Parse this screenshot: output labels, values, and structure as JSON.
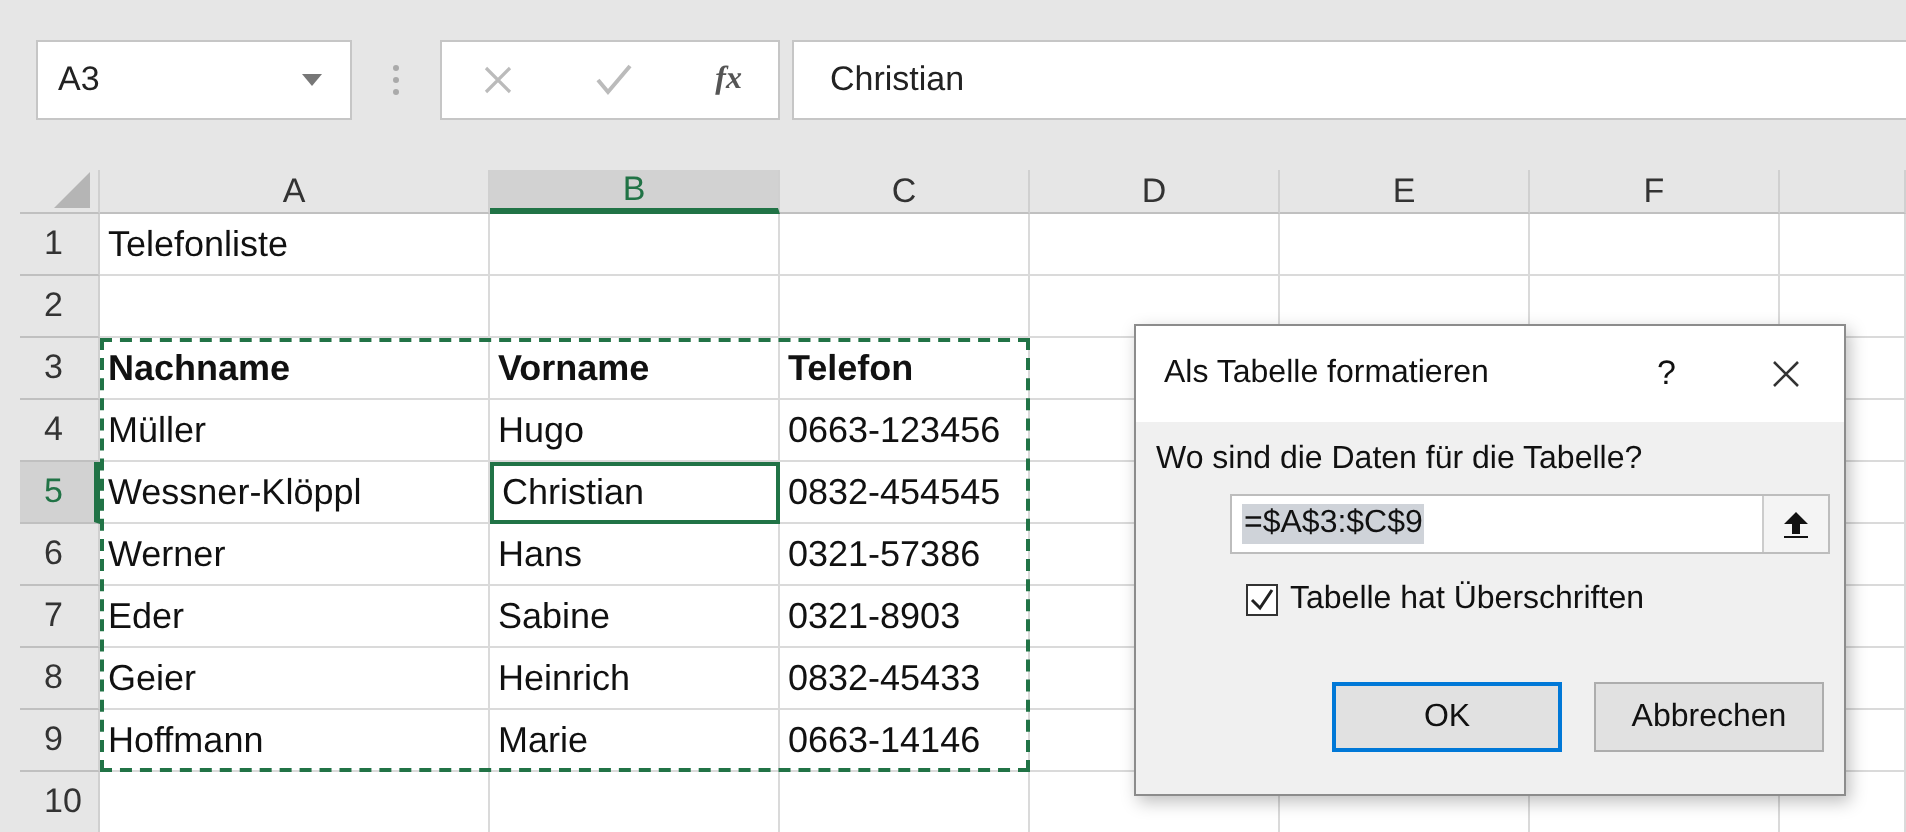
{
  "name_box": {
    "value": "A3"
  },
  "formula_bar": {
    "function_label": "fx",
    "value": "Christian"
  },
  "columns": [
    {
      "label": "A",
      "selected": false
    },
    {
      "label": "B",
      "selected": true
    },
    {
      "label": "C",
      "selected": false
    },
    {
      "label": "D",
      "selected": false
    },
    {
      "label": "E",
      "selected": false
    },
    {
      "label": "F",
      "selected": false
    }
  ],
  "rows": [
    {
      "number": "1",
      "selected": false,
      "cells": [
        {
          "text": "Telefonliste",
          "bold": false,
          "active": false
        }
      ]
    },
    {
      "number": "2",
      "selected": false
    },
    {
      "number": "3",
      "selected": false,
      "cells": [
        {
          "text": "Nachname",
          "bold": true,
          "active": false
        },
        {
          "text": "Vorname",
          "bold": true,
          "active": false
        },
        {
          "text": "Telefon",
          "bold": true,
          "active": false
        }
      ]
    },
    {
      "number": "4",
      "selected": false,
      "cells": [
        {
          "text": "Müller",
          "bold": false,
          "active": false
        },
        {
          "text": "Hugo",
          "bold": false,
          "active": false
        },
        {
          "text": "0663-123456",
          "bold": false,
          "active": false
        }
      ]
    },
    {
      "number": "5",
      "selected": true,
      "cells": [
        {
          "text": "Wessner-Klöppl",
          "bold": false,
          "active": false
        },
        {
          "text": "Christian",
          "bold": false,
          "active": true
        },
        {
          "text": "0832-454545",
          "bold": false,
          "active": false
        }
      ]
    },
    {
      "number": "6",
      "selected": false,
      "cells": [
        {
          "text": "Werner",
          "bold": false,
          "active": false
        },
        {
          "text": "Hans",
          "bold": false,
          "active": false
        },
        {
          "text": "0321-57386",
          "bold": false,
          "active": false
        }
      ]
    },
    {
      "number": "7",
      "selected": false,
      "cells": [
        {
          "text": "Eder",
          "bold": false,
          "active": false
        },
        {
          "text": "Sabine",
          "bold": false,
          "active": false
        },
        {
          "text": "0321-8903",
          "bold": false,
          "active": false
        }
      ]
    },
    {
      "number": "8",
      "selected": false,
      "cells": [
        {
          "text": "Geier",
          "bold": false,
          "active": false
        },
        {
          "text": "Heinrich",
          "bold": false,
          "active": false
        },
        {
          "text": "0832-45433",
          "bold": false,
          "active": false
        }
      ]
    },
    {
      "number": "9",
      "selected": false,
      "cells": [
        {
          "text": "Hoffmann",
          "bold": false,
          "active": false
        },
        {
          "text": "Marie",
          "bold": false,
          "active": false
        },
        {
          "text": "0663-14146",
          "bold": false,
          "active": false
        }
      ]
    },
    {
      "number": "10",
      "selected": false
    }
  ],
  "dialog": {
    "title": "Als Tabelle formatieren",
    "help": "?",
    "prompt": "Wo sind die Daten für die Tabelle?",
    "range": "=$A$3:$C$9",
    "headers_checkbox": {
      "label": "Tabelle hat Überschriften",
      "checked": true
    },
    "buttons": [
      {
        "label": "OK",
        "default": true
      },
      {
        "label": "Abbrechen",
        "default": false
      }
    ]
  }
}
